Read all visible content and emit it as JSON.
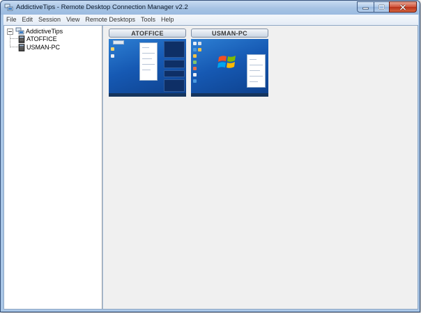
{
  "window": {
    "title": "AddictiveTips - Remote Desktop Connection Manager v2.2"
  },
  "menu": [
    "File",
    "Edit",
    "Session",
    "View",
    "Remote Desktops",
    "Tools",
    "Help"
  ],
  "tree": {
    "root": "AddictiveTips",
    "children": [
      "ATOFFICE",
      "USMAN-PC"
    ]
  },
  "thumbnails": [
    {
      "name": "ATOFFICE"
    },
    {
      "name": "USMAN-PC"
    }
  ],
  "colors": {
    "desktop_blue": "#1659b3",
    "title_bar": "#a6c3e4",
    "close_red": "#c7432a"
  },
  "icons": {
    "app": "network-computers-icon",
    "group": "network-group-icon",
    "server": "computer-icon"
  }
}
